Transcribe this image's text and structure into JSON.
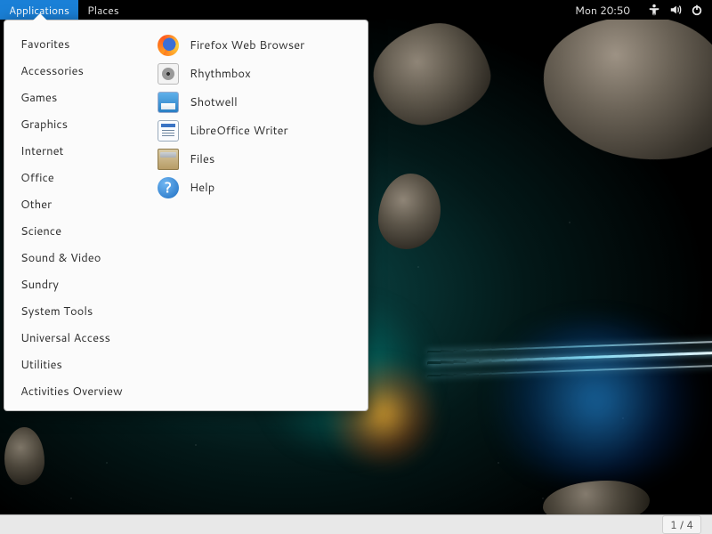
{
  "topbar": {
    "applications_label": "Applications",
    "places_label": "Places",
    "clock": "Mon 20:50"
  },
  "menu": {
    "categories": [
      "Favorites",
      "Accessories",
      "Games",
      "Graphics",
      "Internet",
      "Office",
      "Other",
      "Science",
      "Sound & Video",
      "Sundry",
      "System Tools",
      "Universal Access",
      "Utilities"
    ],
    "activities_label": "Activities Overview",
    "apps": [
      {
        "label": "Firefox Web Browser",
        "icon": "firefox"
      },
      {
        "label": "Rhythmbox",
        "icon": "rhythmbox"
      },
      {
        "label": "Shotwell",
        "icon": "shotwell"
      },
      {
        "label": "LibreOffice Writer",
        "icon": "writer"
      },
      {
        "label": "Files",
        "icon": "files"
      },
      {
        "label": "Help",
        "icon": "help"
      }
    ]
  },
  "bottombar": {
    "workspace_indicator": "1 / 4"
  },
  "icons": {
    "help_glyph": "?"
  }
}
